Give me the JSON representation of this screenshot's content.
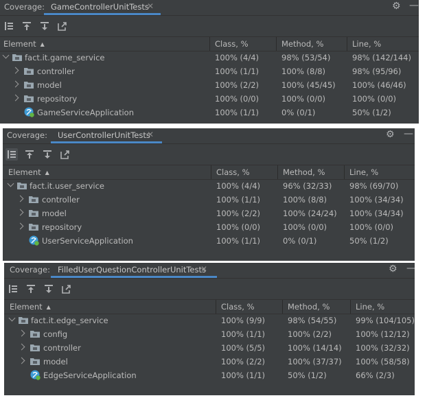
{
  "colors": {
    "panel_bg": "#3c3f41",
    "tab_underline": "#4a88c7",
    "text": "#bbbbbb",
    "folder": "#9aa7b0",
    "app_icon_blue": "#3d9bd6",
    "app_icon_green": "#62b543"
  },
  "panels": [
    {
      "coverage_label": "Coverage:",
      "tab_label": "GameControllerUnitTests",
      "columns": {
        "element": "Element",
        "class": "Class, %",
        "method": "Method, %",
        "line": "Line, %"
      },
      "rows": [
        {
          "type": "package-open",
          "element": "fact.it.game_service",
          "class": "100% (4/4)",
          "method": "98% (53/54)",
          "line": "98% (142/144)"
        },
        {
          "type": "package",
          "element": "controller",
          "class": "100% (1/1)",
          "method": "100% (8/8)",
          "line": "98% (95/96)"
        },
        {
          "type": "package",
          "element": "model",
          "class": "100% (2/2)",
          "method": "100% (45/45)",
          "line": "100% (46/46)"
        },
        {
          "type": "package",
          "element": "repository",
          "class": "100% (0/0)",
          "method": "100% (0/0)",
          "line": "100% (0/0)"
        },
        {
          "type": "app",
          "element": "GameServiceApplication",
          "class": "100% (1/1)",
          "method": "0% (0/1)",
          "line": "50% (1/2)"
        }
      ]
    },
    {
      "coverage_label": "Coverage:",
      "tab_label": "UserControllerUnitTests",
      "columns": {
        "element": "Element",
        "class": "Class, %",
        "method": "Method, %",
        "line": "Line, %"
      },
      "rows": [
        {
          "type": "package-open",
          "element": "fact.it.user_service",
          "class": "100% (4/4)",
          "method": "96% (32/33)",
          "line": "98% (69/70)"
        },
        {
          "type": "package",
          "element": "controller",
          "class": "100% (1/1)",
          "method": "100% (8/8)",
          "line": "100% (34/34)"
        },
        {
          "type": "package",
          "element": "model",
          "class": "100% (2/2)",
          "method": "100% (24/24)",
          "line": "100% (34/34)"
        },
        {
          "type": "package",
          "element": "repository",
          "class": "100% (0/0)",
          "method": "100% (0/0)",
          "line": "100% (0/0)"
        },
        {
          "type": "app",
          "element": "UserServiceApplication",
          "class": "100% (1/1)",
          "method": "0% (0/1)",
          "line": "50% (1/2)"
        }
      ]
    },
    {
      "coverage_label": "Coverage:",
      "tab_label": "FilledUserQuestionControllerUnitTests",
      "columns": {
        "element": "Element",
        "class": "Class, %",
        "method": "Method, %",
        "line": "Line, %"
      },
      "rows": [
        {
          "type": "package-open",
          "element": "fact.it.edge_service",
          "class": "100% (9/9)",
          "method": "98% (54/55)",
          "line": "99% (104/105)"
        },
        {
          "type": "package",
          "element": "config",
          "class": "100% (1/1)",
          "method": "100% (2/2)",
          "line": "100% (12/12)"
        },
        {
          "type": "package",
          "element": "controller",
          "class": "100% (5/5)",
          "method": "100% (14/14)",
          "line": "100% (32/32)"
        },
        {
          "type": "package",
          "element": "model",
          "class": "100% (2/2)",
          "method": "100% (37/37)",
          "line": "100% (58/58)"
        },
        {
          "type": "app",
          "element": "EdgeServiceApplication",
          "class": "100% (1/1)",
          "method": "50% (1/2)",
          "line": "66% (2/3)"
        }
      ]
    }
  ]
}
